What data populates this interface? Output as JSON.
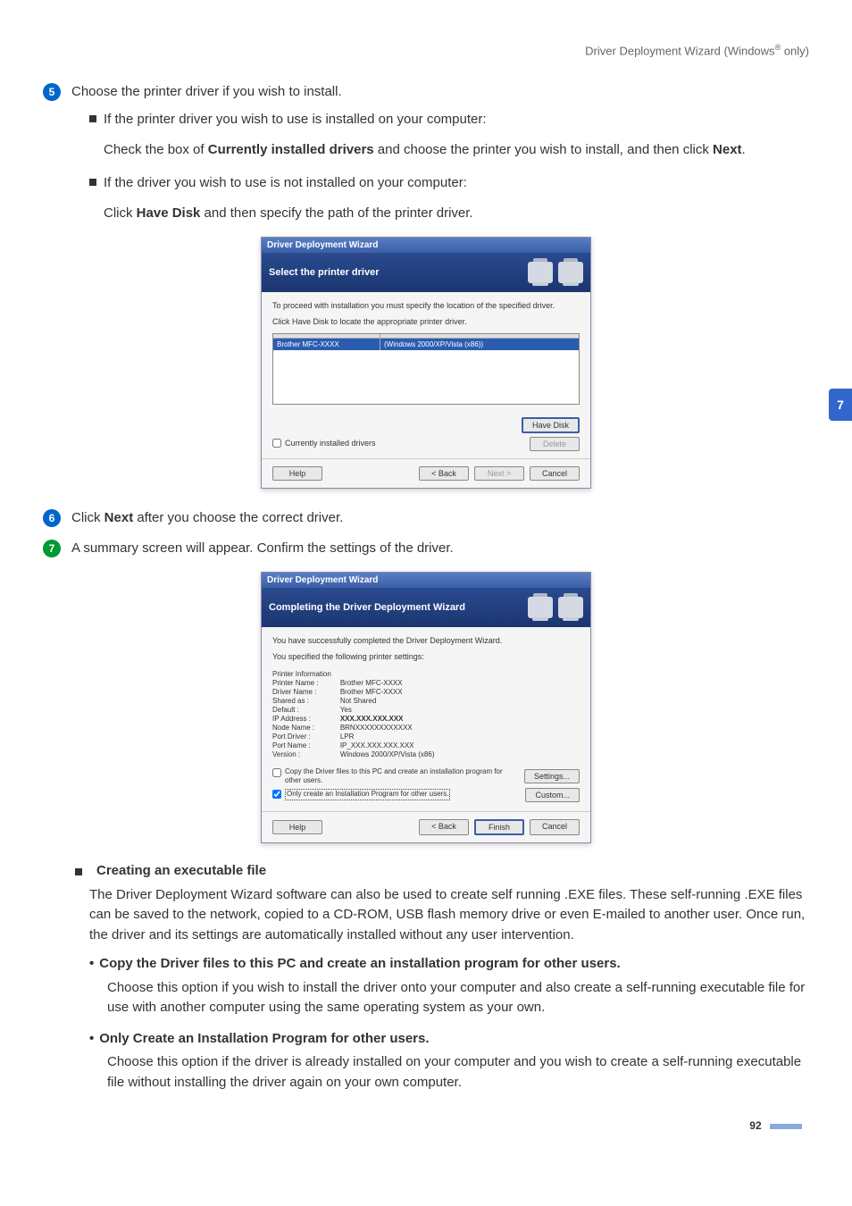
{
  "header": {
    "chapter_title_prefix": "Driver Deployment Wizard (Windows",
    "chapter_title_suffix": " only)"
  },
  "side_tab": "7",
  "page_number": "92",
  "steps": {
    "s5": {
      "num": "5",
      "text": "Choose the printer driver if you wish to install.",
      "bullet_a": "If the printer driver you wish to use is installed on your computer:",
      "para_a1": "Check the box of ",
      "para_a_bold": "Currently installed drivers",
      "para_a2": " and choose the printer you wish to install, and then click ",
      "para_a_bold2": "Next",
      "para_a3": ".",
      "bullet_b": "If the driver you wish to use is not installed on your computer:",
      "para_b1": "Click ",
      "para_b_bold": "Have Disk",
      "para_b2": " and then specify the path of the printer driver."
    },
    "s6": {
      "num": "6",
      "text1": "Click ",
      "bold": "Next",
      "text2": " after you choose the correct driver."
    },
    "s7": {
      "num": "7",
      "text": "A summary screen will appear. Confirm the settings of the driver."
    }
  },
  "dialog1": {
    "titlebar": "Driver Deployment Wizard",
    "header_text": "Select the printer driver",
    "body_line1": "To proceed with installation you must specify the location of the specified driver.",
    "body_line2": "Click Have Disk to locate the appropriate printer driver.",
    "col1": "",
    "col2": "",
    "sel_name": "Brother  MFC-XXXX",
    "sel_loc": "(Windows 2000/XP/Vista (x86))",
    "chk_label": "Currently installed drivers",
    "btn_havedisk": "Have Disk",
    "btn_delete": "Delete",
    "btn_help": "Help",
    "btn_back": "< Back",
    "btn_next": "Next >",
    "btn_cancel": "Cancel"
  },
  "dialog2": {
    "titlebar": "Driver Deployment Wizard",
    "header_text": "Completing the Driver Deployment Wizard",
    "line1": "You have successfully completed the Driver Deployment Wizard.",
    "line2": "You specified the following printer settings:",
    "labels": {
      "l0": "Printer Information",
      "l1": "Printer Name :",
      "l2": "Driver Name :",
      "l3": "Shared as :",
      "l4": "Default :",
      "l5": "IP Address :",
      "l6": "Node Name :",
      "l7": "Port Driver :",
      "l8": "Port Name :",
      "l9": "Version :"
    },
    "values": {
      "v1": "Brother  MFC-XXXX",
      "v2": "Brother  MFC-XXXX",
      "v3": "Not Shared",
      "v4": "Yes",
      "v5": "XXX.XXX.XXX.XXX",
      "v6": "BRNXXXXXXXXXXXX",
      "v7": "LPR",
      "v8": "IP_XXX.XXX.XXX.XXX",
      "v9": "Windows 2000/XP/Vista (x86)"
    },
    "opt1": "Copy the Driver files to this PC and create an installation program for other users.",
    "opt2": "Only create an Installation Program for other users.",
    "btn_settings": "Settings...",
    "btn_custom": "Custom...",
    "btn_help": "Help",
    "btn_back": "< Back",
    "btn_finish": "Finish",
    "btn_cancel": "Cancel"
  },
  "exec": {
    "heading": "Creating an executable file",
    "para": "The Driver Deployment Wizard software can also be used to create self running .EXE files. These self-running .EXE files can be saved to the network, copied to a CD-ROM, USB flash memory drive or even E-mailed to another user. Once run, the driver and its settings are automatically installed without any user intervention.",
    "opt1_title": "Copy the Driver files to this PC and create an installation program for other users.",
    "opt1_text": "Choose this option if you wish to install the driver onto your computer and also create a self-running executable file for use with another computer using the same operating system as your own.",
    "opt2_title": "Only Create an Installation Program for other users.",
    "opt2_text": "Choose this option if the driver is already installed on your computer and you wish to create a self-running executable file without installing the driver again on your own computer."
  }
}
